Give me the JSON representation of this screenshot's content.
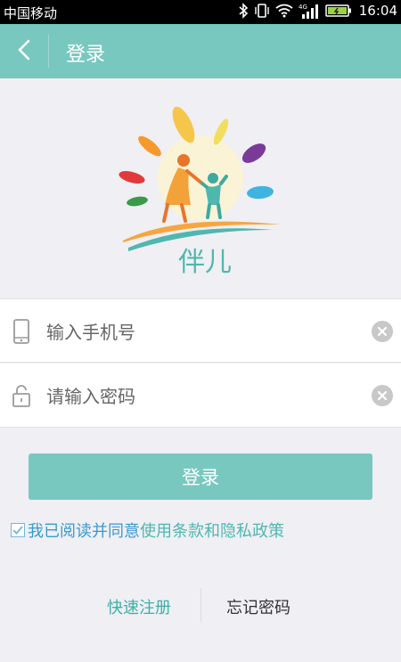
{
  "status_bar": {
    "carrier": "中国移动",
    "network": "4G",
    "time": "16:04"
  },
  "header": {
    "title": "登录",
    "back_icon": "back-arrow-icon"
  },
  "logo": {
    "brand_text": "伴儿"
  },
  "form": {
    "phone_placeholder": "输入手机号",
    "password_placeholder": "请输入密码",
    "login_label": "登录"
  },
  "agreement": {
    "prefix": "我已阅读并同意",
    "terms_link": "使用条款和隐私政策"
  },
  "footer": {
    "register_label": "快速注册",
    "forgot_label": "忘记密码"
  },
  "colors": {
    "accent": "#78c8c0",
    "link": "#3bb0a6",
    "agree_text": "#3a9ad0"
  }
}
